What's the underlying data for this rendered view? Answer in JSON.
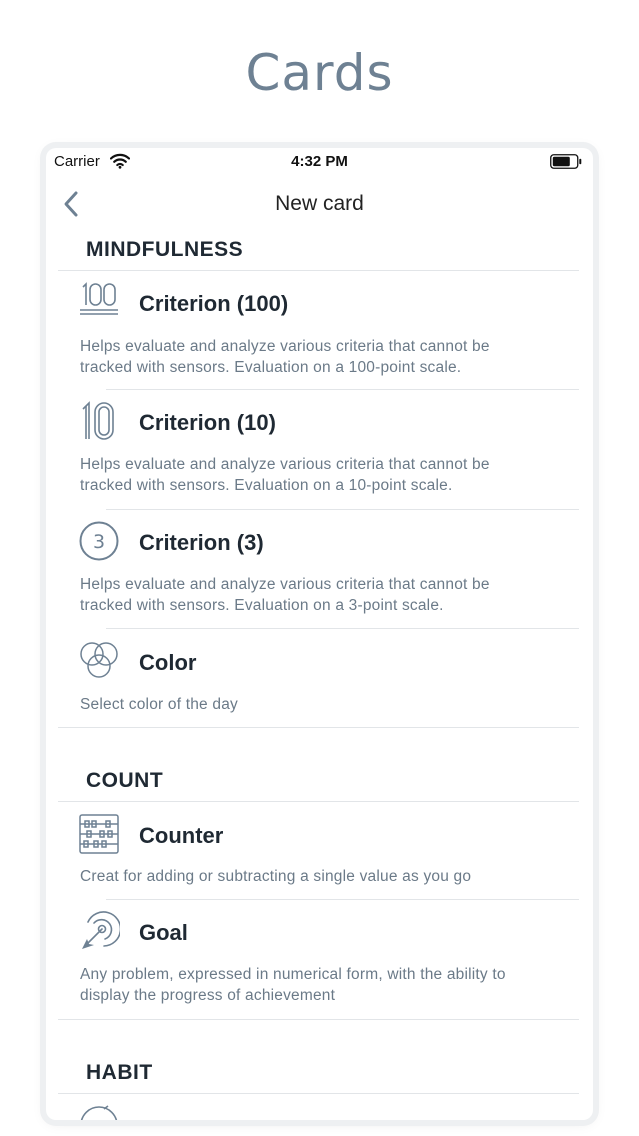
{
  "promo": {
    "title": "Cards"
  },
  "status_bar": {
    "carrier": "Carrier",
    "time": "4:32 PM",
    "icons": [
      "wifi-icon",
      "battery-icon"
    ]
  },
  "nav": {
    "title": "New card",
    "back_icon": "chevron-left-icon"
  },
  "sections": [
    {
      "title": "MINDFULNESS"
    },
    {
      "title": "COUNT"
    },
    {
      "title": "HABIT"
    }
  ],
  "items": [
    {
      "icon": "hundred-icon",
      "title": "Criterion (100)",
      "desc1": "Helps evaluate and analyze various criteria that cannot be",
      "desc2": "tracked with sensors. Evaluation on a 100-point scale."
    },
    {
      "icon": "ten-icon",
      "title": "Criterion (10)",
      "desc1": "Helps evaluate and analyze various criteria that cannot be",
      "desc2": "tracked with sensors. Evaluation on a 10-point scale."
    },
    {
      "icon": "three-circle-icon",
      "title": "Criterion (3)",
      "desc1": "Helps evaluate and analyze various criteria that cannot be",
      "desc2": "tracked with sensors. Evaluation on a 3-point scale."
    },
    {
      "icon": "color-circles-icon",
      "title": "Color",
      "desc1": "Select color of the day",
      "desc2": ""
    },
    {
      "icon": "abacus-icon",
      "title": "Counter",
      "desc1": "Creat for adding or subtracting a single value as you go",
      "desc2": ""
    },
    {
      "icon": "target-icon",
      "title": "Goal",
      "desc1": "Any problem, expressed in numerical form, with the ability to",
      "desc2": "display the progress of achievement"
    }
  ],
  "colors": {
    "accent": "#6e8193",
    "text": "#1f2933",
    "muted": "#6b7a88",
    "divider": "#e2e5e8"
  }
}
